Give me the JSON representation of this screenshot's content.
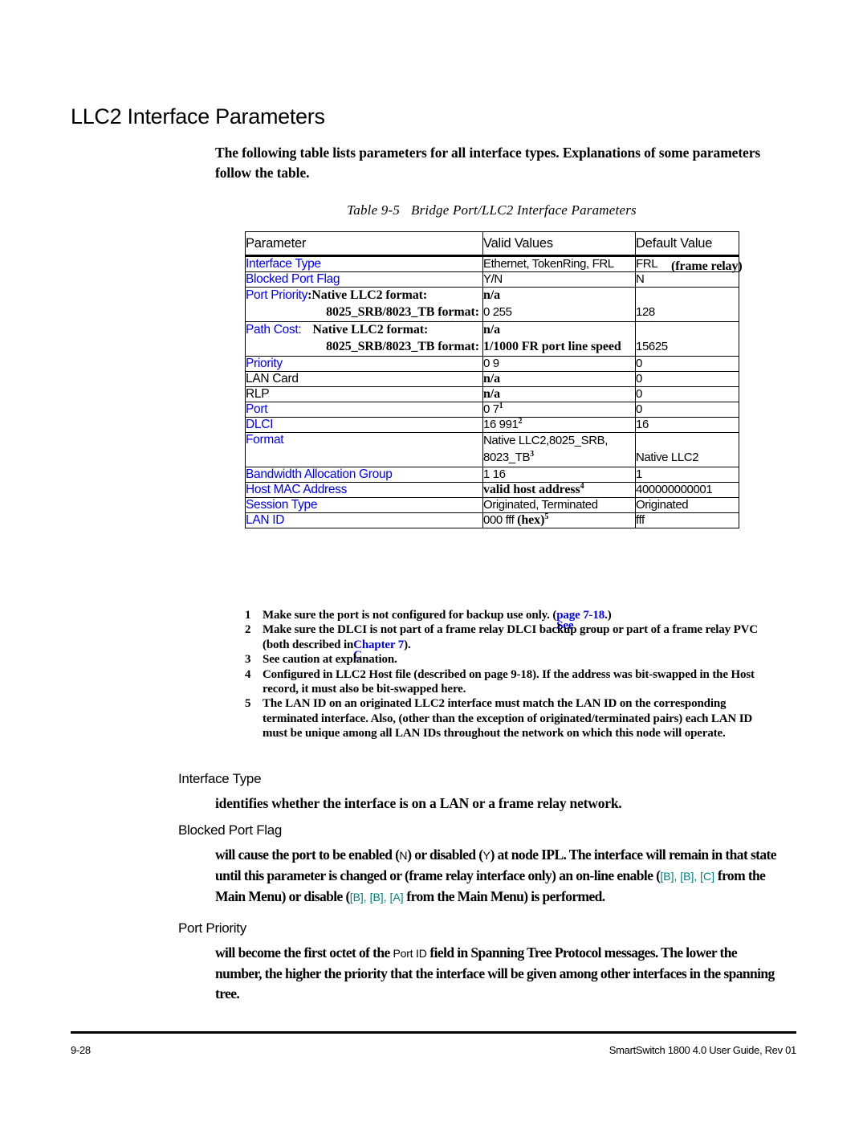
{
  "page": {
    "title": "LLC2 Interface Parameters",
    "intro": "The following table lists parameters for all interface types. Explanations of some parameters follow the table."
  },
  "table": {
    "caption_number": "Table 9-5",
    "caption_text": "Bridge Port/LLC2 Interface Parameters",
    "headers": [
      "Parameter",
      "Valid Values",
      "Default Value"
    ],
    "rows": [
      {
        "parameter": "Interface Type",
        "param_color": "#0000ee",
        "valid": "Ethernet, TokenRing, FRL",
        "default": "FRL",
        "default_note": "(frame relay)"
      },
      {
        "parameter": "Blocked Port Flag",
        "param_color": "#0000ee",
        "valid": "Y/N",
        "default": "N"
      },
      {
        "parameter": "Port Priority",
        "param_color": "#0000ee",
        "param_suffix": ":",
        "sub_labels": [
          "Native LLC2 format:",
          "8025_SRB/8023_TB format:"
        ],
        "sub_valid": [
          "n/a",
          "0 255"
        ],
        "sub_default": [
          "",
          "128"
        ]
      },
      {
        "parameter": "Path Cost",
        "param_color": "#0000ee",
        "param_suffix": ":",
        "sub_labels": [
          "Native LLC2 format:",
          "8025_SRB/8023_TB format:"
        ],
        "sub_valid": [
          "n/a",
          "1/1000 FR port line speed"
        ],
        "sub_default": [
          "",
          "15625"
        ]
      },
      {
        "parameter": "Priority",
        "param_color": "#0000ee",
        "valid": "0 9",
        "default": "0"
      },
      {
        "parameter": "LAN Card",
        "param_color": "#000000",
        "valid": "n/a",
        "valid_bold": true,
        "default": "0"
      },
      {
        "parameter": "RLP",
        "param_color": "#000000",
        "valid": "n/a",
        "valid_bold": true,
        "default": "0"
      },
      {
        "parameter": "Port",
        "param_color": "#0000ee",
        "valid": "0 7",
        "valid_footnote": "1",
        "default": "0"
      },
      {
        "parameter": "DLCI",
        "param_color": "#0000ee",
        "valid": "16 991",
        "valid_footnote": "2",
        "default": "16"
      },
      {
        "parameter": "Format",
        "param_color": "#0000ee",
        "valid_line1": "Native LLC2,8025_SRB,",
        "valid_line2": "8023_TB",
        "valid_footnote": "3",
        "default": "Native LLC2"
      },
      {
        "parameter": "Bandwidth Allocation Group",
        "param_color": "#0000ee",
        "valid": "1 16",
        "default": "1"
      },
      {
        "parameter": "Host MAC Address",
        "param_color": "#0000ee",
        "valid": "valid host address",
        "valid_bold": true,
        "valid_footnote": "4",
        "default": "400000000001"
      },
      {
        "parameter": "Session Type",
        "param_color": "#0000ee",
        "valid": "Originated, Terminated",
        "default": "Originated"
      },
      {
        "parameter": "LAN ID",
        "param_color": "#0000ee",
        "valid": "000 fff",
        "valid_note": "(hex)",
        "valid_footnote": "5",
        "default": "fff"
      }
    ]
  },
  "footnotes": [
    {
      "num": "1",
      "text_a": "Make sure the port is not configured for backup use only. (",
      "link_overlap": "See",
      "link": "page 7-18",
      "text_b": ".)"
    },
    {
      "num": "2",
      "text_a": "Make sure the DLCI is not part of a frame relay DLCI backup group or part of a frame relay PVC (both described in",
      "link_overlap": "C",
      "link": "Chapter 7",
      "text_b": ")."
    },
    {
      "num": "3",
      "text_a": "See caution at explanation."
    },
    {
      "num": "4",
      "text_a": "Configured in LLC2 Host file (described on page 9-18). If the address was bit-swapped in the Host record, it must also be bit-swapped here."
    },
    {
      "num": "5",
      "text_a": "The LAN ID on an originated LLC2 interface must match the LAN ID on the corresponding terminated interface. Also, (other than the exception of originated/terminated pairs) each LAN ID must be unique among all LAN IDs throughout the network on which this node will operate."
    }
  ],
  "sections": [
    {
      "term": "Interface Type",
      "body_1": "identifies whether the interface is on a LAN or a frame relay network."
    },
    {
      "term": "Blocked Port Flag",
      "body_1": "will cause the port to be enabled (",
      "val_n": "N",
      "body_2": ") or disabled (",
      "val_y": "Y",
      "body_3": ") at node IPL. The interface will remain in that state until this parameter is changed or (frame relay interface only) an on-line enable (",
      "keys_enable": "[B], [B], [C]",
      "body_4": " from the Main Menu) or disable (",
      "keys_disable": "[B], [B], [A]",
      "body_5": " from the Main Menu) is performed."
    },
    {
      "term": "Port Priority",
      "body_1": "will become the first octet of the ",
      "ui_field": "Port ID",
      "body_2": " field in Spanning Tree Protocol messages. The lower the number, the higher the priority that the interface will be given among other interfaces in the spanning tree."
    }
  ],
  "footer": {
    "page_number": "9-28",
    "doc_title": "SmartSwitch 1800 4.0 User Guide, Rev 01"
  }
}
